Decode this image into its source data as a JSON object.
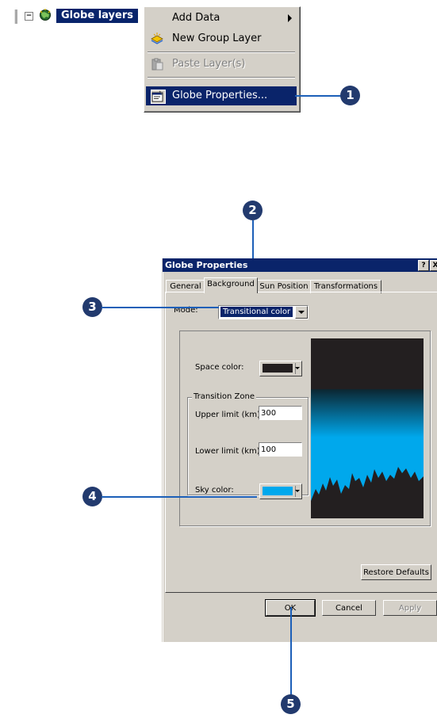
{
  "toc": {
    "layer_label": "Globe layers",
    "expander": "−",
    "globe_icon": "globe-icon"
  },
  "context_menu": {
    "items": [
      {
        "label": "Add Data",
        "icon": "",
        "has_submenu": true,
        "state": "normal"
      },
      {
        "label": "New Group Layer",
        "icon": "group-layer-icon",
        "state": "normal"
      },
      {
        "label": "Paste Layer(s)",
        "icon": "paste-icon",
        "state": "disabled"
      },
      {
        "label": "Globe Properties...",
        "icon": "properties-icon",
        "state": "selected"
      }
    ]
  },
  "callouts": [
    "1",
    "2",
    "3",
    "4",
    "5"
  ],
  "dialog": {
    "title": "Globe Properties",
    "title_buttons": [
      "?",
      "X"
    ],
    "tabs": [
      {
        "label": "General",
        "active": false
      },
      {
        "label": "Background",
        "active": true
      },
      {
        "label": "Sun Position",
        "active": false
      },
      {
        "label": "Transformations",
        "active": false
      }
    ],
    "mode_label": "Mode:",
    "mode_value": "Transitional color",
    "space_color_label": "Space color:",
    "space_color": "#231f20",
    "transition_zone_title": "Transition Zone",
    "upper_limit_label": "Upper limit (km):",
    "upper_limit_value": "300",
    "lower_limit_label": "Lower limit (km):",
    "lower_limit_value": "100",
    "sky_color_label": "Sky color:",
    "sky_color": "#00a8ec",
    "restore_defaults_label": "Restore Defaults",
    "ok_label": "OK",
    "cancel_label": "Cancel",
    "apply_label": "Apply"
  },
  "colors": {
    "accent_callout": "#223a6e",
    "callout_line": "#1c5fb8",
    "selection": "#0a246a",
    "dialog_face": "#d4d0c8"
  }
}
